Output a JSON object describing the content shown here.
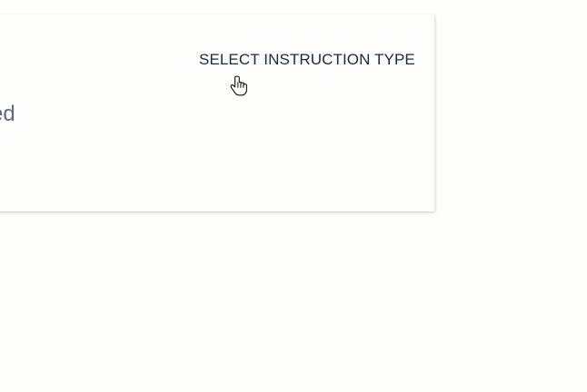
{
  "card": {
    "partial_text": "ed",
    "action_label": "SELECT INSTRUCTION TYPE"
  },
  "cursor": {
    "icon": "hand-pointer-icon"
  }
}
